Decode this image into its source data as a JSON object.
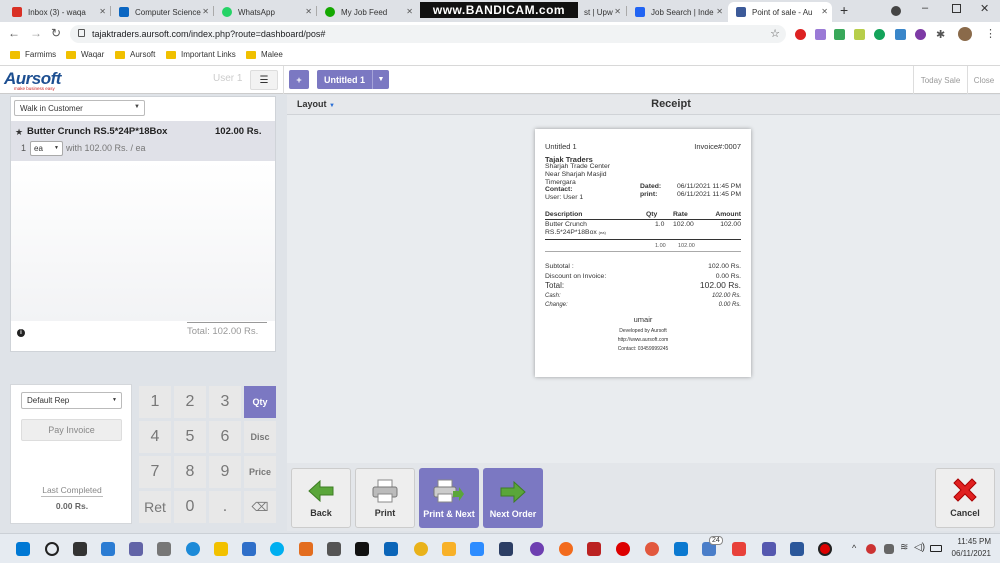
{
  "browser": {
    "tabs": [
      {
        "label": "Inbox (3) - waqa",
        "color": "#d93025"
      },
      {
        "label": "Computer Science",
        "color": "#0a66c2"
      },
      {
        "label": "WhatsApp",
        "color": "#25d366"
      },
      {
        "label": "My Job Feed",
        "color": "#14a800"
      },
      {
        "label": "st | Upw",
        "color": "#14a800"
      },
      {
        "label": "Job Search | Inde",
        "color": "#2164f3"
      },
      {
        "label": "Point of sale - Au",
        "color": "#3c5a99"
      }
    ],
    "watermark": "www.BANDICAM.com",
    "url": "tajaktraders.aursoft.com/index.php?route=dashboard/pos#",
    "bookmarks": [
      "Farmims",
      "Waqar",
      "Aursoft",
      "Important Links",
      "Malee"
    ]
  },
  "app": {
    "logo": "Aursoft",
    "logo_tagline": "make business easy",
    "user": "User 1",
    "order_tab": "Untitled 1",
    "add_label": "+",
    "today_sale": "Today Sale",
    "close": "Close"
  },
  "cart": {
    "customer": "Walk in Customer",
    "item": {
      "star": "★",
      "name": "Butter Crunch RS.5*24P*18Box",
      "price": "102.00 Rs.",
      "qty": "1",
      "unit": "ea",
      "detail": "with 102.00 Rs. / ea"
    },
    "total": "Total: 102.00 Rs."
  },
  "sidebar_bottom": {
    "rep": "Default Rep",
    "pay": "Pay Invoice",
    "last_completed_label": "Last Completed",
    "last_completed_value": "0.00 Rs."
  },
  "keypad": {
    "keys": [
      "1",
      "2",
      "3",
      "Qty",
      "4",
      "5",
      "6",
      "Disc",
      "7",
      "8",
      "9",
      "Price",
      "Ret",
      "0",
      ".",
      "⌫"
    ]
  },
  "receipt_panel": {
    "layout": "Layout",
    "title": "Receipt"
  },
  "receipt": {
    "order_name": "Untitled 1",
    "invoice": "Invoice#:0007",
    "company": "Tajak Traders",
    "addr1": "Sharjah Trade Center",
    "addr2": "Near Sharjah Masjid",
    "addr3": "Timergara",
    "contact_label": "Contact:",
    "user": "User: User 1",
    "dated_label": "Dated:",
    "dated": "06/11/2021 11:45 PM",
    "print_label": "print:",
    "print": "06/11/2021 11:45 PM",
    "col_desc": "Description",
    "col_qty": "Qty",
    "col_rate": "Rate",
    "col_amount": "Amount",
    "line_desc1": "Butter Crunch",
    "line_desc2": "RS.5*24P*18Box",
    "line_unit": "(ea)",
    "line_qty": "1.0",
    "line_rate": "102.00",
    "line_amount": "102.00",
    "sum_qty": "1.00",
    "sum_rate": "102.00",
    "subtotal_label": "Subtotal :",
    "subtotal": "102.00 Rs.",
    "discount_label": "Discount on Invoice:",
    "discount": "0.00 Rs.",
    "total_label": "Total:",
    "total": "102.00 Rs.",
    "cash_label": "Cash:",
    "cash": "102.00 Rs.",
    "change_label": "Change:",
    "change": "0.00 Rs.",
    "cashier": "umair",
    "dev": "Developed by Aursoft",
    "site": "http://www.aursoft.com",
    "contact": "Contact: 03459999245"
  },
  "actions": {
    "back": "Back",
    "print": "Print",
    "print_next": "Print & Next",
    "next_order": "Next Order",
    "cancel": "Cancel"
  },
  "taskbar": {
    "time": "11:45 PM",
    "date": "06/11/2021",
    "badge": "24"
  }
}
